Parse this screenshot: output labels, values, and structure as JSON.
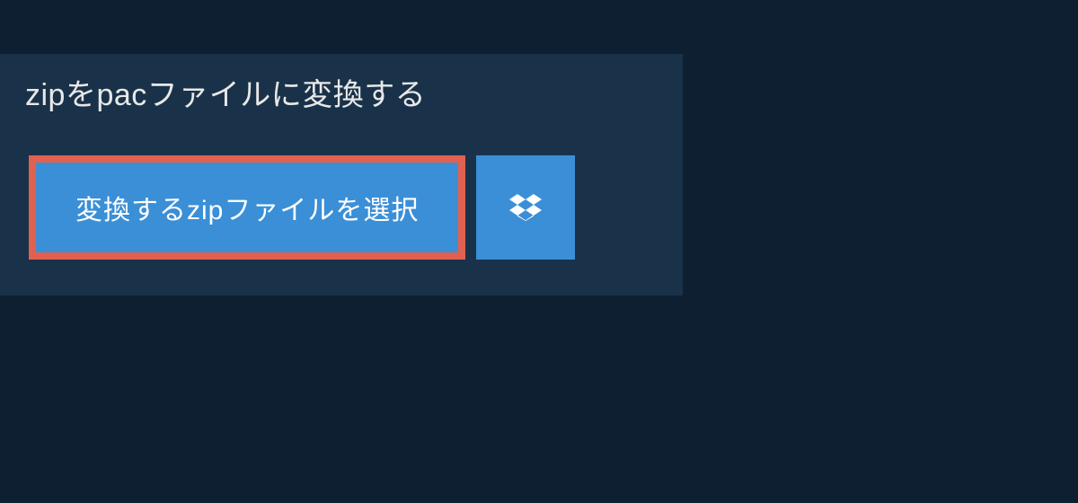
{
  "header": {
    "title": "zipをpacファイルに変換する"
  },
  "actions": {
    "select_file_label": "変換するzipファイルを選択"
  },
  "colors": {
    "background": "#0d1f31",
    "panel": "#193249",
    "button": "#3b8fd6",
    "highlight_border": "#e0614f",
    "text_light": "#e8e8e8",
    "text_white": "#ffffff"
  }
}
